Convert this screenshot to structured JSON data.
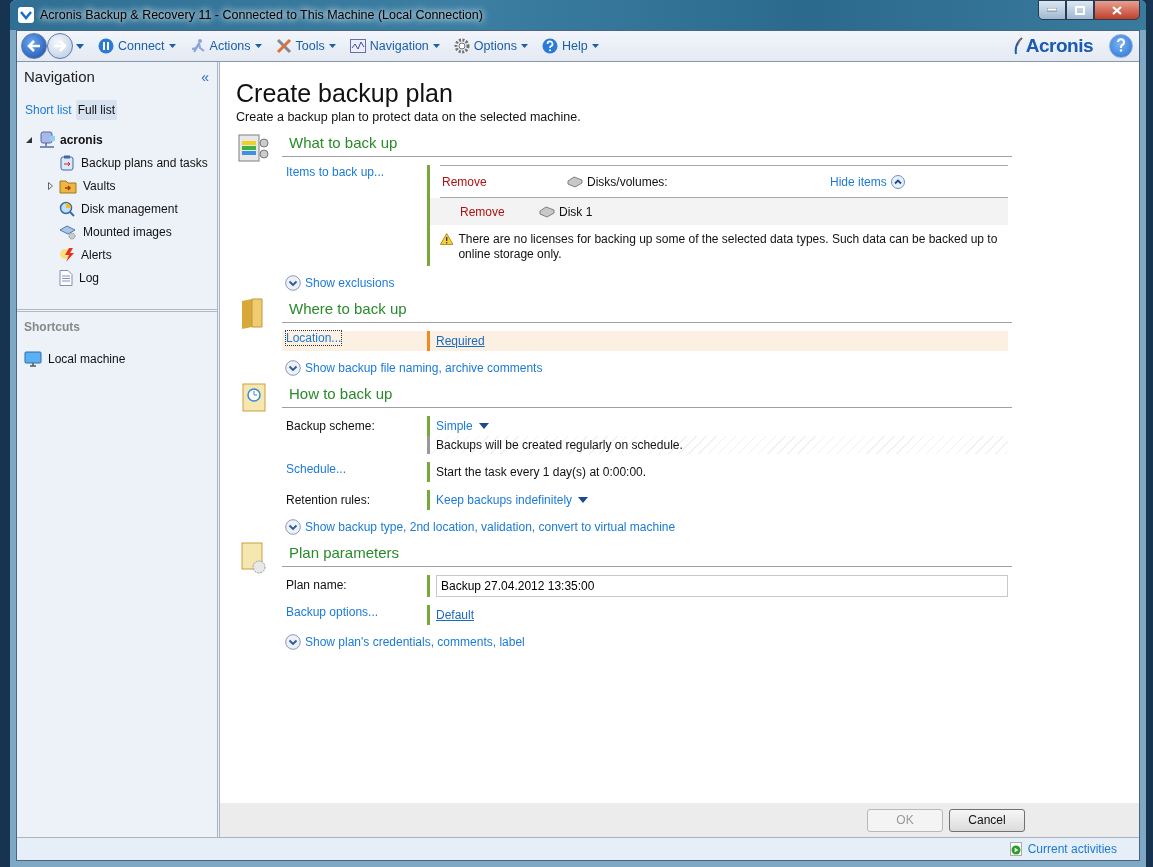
{
  "window": {
    "title": "Acronis Backup & Recovery 11 - Connected to This Machine (Local Connection)"
  },
  "toolbar": {
    "menus": [
      {
        "label": "Connect",
        "kind": "connect"
      },
      {
        "label": "Actions",
        "kind": "actions"
      },
      {
        "label": "Tools",
        "kind": "tools"
      },
      {
        "label": "Navigation",
        "kind": "navigation"
      },
      {
        "label": "Options",
        "kind": "options"
      },
      {
        "label": "Help",
        "kind": "help"
      }
    ],
    "logo": "Acronis"
  },
  "navigation": {
    "title": "Navigation",
    "collapse": "«",
    "tabs": [
      {
        "label": "Short list",
        "selected": false
      },
      {
        "label": "Full list",
        "selected": true
      }
    ],
    "tree": {
      "label": "acronis",
      "expanded": true,
      "children": [
        {
          "label": "Backup plans and tasks",
          "kind": "plans",
          "expandable": false
        },
        {
          "label": "Vaults",
          "kind": "vaults",
          "expandable": true
        },
        {
          "label": "Disk management",
          "kind": "disks",
          "expandable": false
        },
        {
          "label": "Mounted images",
          "kind": "mounted",
          "expandable": false
        },
        {
          "label": "Alerts",
          "kind": "alerts",
          "expandable": false
        },
        {
          "label": "Log",
          "kind": "log",
          "expandable": false
        }
      ]
    }
  },
  "shortcuts": {
    "title": "Shortcuts",
    "items": [
      {
        "label": "Local machine"
      }
    ]
  },
  "page": {
    "title": "Create backup plan",
    "subtitle": "Create a backup plan to protect data on the selected machine.",
    "sections": [
      {
        "heading": "What to back up",
        "kind": "what",
        "rows": [
          {
            "kind": "items",
            "label": "Items to back up...",
            "label_link": true,
            "focused": false,
            "highlighted": false,
            "color": "#77a83a",
            "group": {
              "remove": "Remove",
              "label": "Disks/volumes:",
              "toggle": "Hide items"
            },
            "entries": [
              {
                "remove": "Remove",
                "label": "Disk 1"
              }
            ],
            "warning": "There are no licenses for backing up some of the selected data types. Such data can be backed up to online storage only."
          }
        ],
        "toggle": "Show exclusions"
      },
      {
        "heading": "Where to back up",
        "kind": "where",
        "rows": [
          {
            "kind": "value",
            "label": "Location...",
            "label_link": true,
            "focused": true,
            "highlighted": true,
            "color": "#f08a24",
            "value": {
              "kind": "link",
              "text": "Required"
            }
          }
        ],
        "toggle": "Show backup file naming, archive comments"
      },
      {
        "heading": "How to back up",
        "kind": "how",
        "rows": [
          {
            "kind": "value",
            "label": "Backup scheme:",
            "label_link": false,
            "focused": false,
            "highlighted": false,
            "color": "#77a83a",
            "value": {
              "kind": "dropdown",
              "text": "Simple"
            },
            "note": "Backups will be created regularly on schedule."
          },
          {
            "kind": "value",
            "label": "Schedule...",
            "label_link": true,
            "focused": false,
            "highlighted": false,
            "color": "#77a83a",
            "value": {
              "kind": "text",
              "text": "Start the task every 1 day(s) at 0:00:00."
            }
          },
          {
            "kind": "value",
            "label": "Retention rules:",
            "label_link": false,
            "focused": false,
            "highlighted": false,
            "color": "#77a83a",
            "value": {
              "kind": "dropdown",
              "text": "Keep backups indefinitely"
            }
          }
        ],
        "toggle": "Show backup type, 2nd location, validation, convert to virtual machine"
      },
      {
        "heading": "Plan parameters",
        "kind": "plan",
        "rows": [
          {
            "kind": "value",
            "label": "Plan name:",
            "label_link": false,
            "focused": false,
            "highlighted": false,
            "color": "#77a83a",
            "value": {
              "kind": "input",
              "text": "Backup 27.04.2012 13:35:00"
            }
          },
          {
            "kind": "value",
            "label": "Backup options...",
            "label_link": true,
            "focused": false,
            "highlighted": false,
            "color": "#77a83a",
            "value": {
              "kind": "link",
              "text": "Default"
            }
          }
        ],
        "toggle": "Show plan's credentials, comments, label"
      }
    ]
  },
  "buttons": [
    {
      "label": "OK",
      "disabled": true
    },
    {
      "label": "Cancel",
      "disabled": false
    }
  ],
  "status_bar": {
    "activities": "Current activities"
  }
}
